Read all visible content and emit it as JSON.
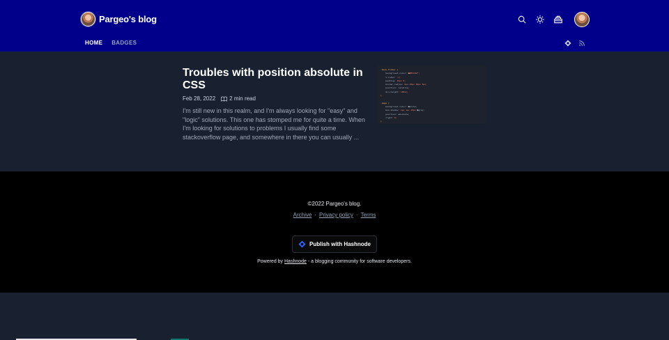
{
  "header": {
    "blog_name": "Pargeo's blog",
    "icons": [
      "search-icon",
      "sun-icon",
      "dashboard-icon",
      "user-avatar"
    ],
    "nav": [
      {
        "label": "HOME",
        "active": true
      },
      {
        "label": "BADGES",
        "active": false
      }
    ],
    "nav_icons": [
      "hashnode-icon",
      "rss-icon"
    ]
  },
  "post": {
    "title": "Troubles with position absolute in CSS",
    "date": "Feb 28, 2022",
    "read_time": "2 min read",
    "excerpt": "I'm still new in this realm, and I'm always looking for \"easy\" and \"logic\" solutions. This one has stomped me for quite a time. When I'm looking for solutions to problems I usually find some stackoverflow page, and somewhere in there you can usually ..."
  },
  "footer": {
    "copyright": "©2022 Pargeo's blog.",
    "links": [
      "Archive",
      "Privacy policy",
      "Terms"
    ],
    "separator": "·",
    "publish_label": "Publish with Hashnode",
    "powered_prefix": "Powered by",
    "powered_link": "Hashnode",
    "powered_suffix": "- a blogging community for software developers."
  },
  "colors": {
    "header_bg": "#00008b",
    "page_bg": "#192030",
    "footer_bg": "#000000",
    "hashnode_blue": "#2962ff"
  }
}
